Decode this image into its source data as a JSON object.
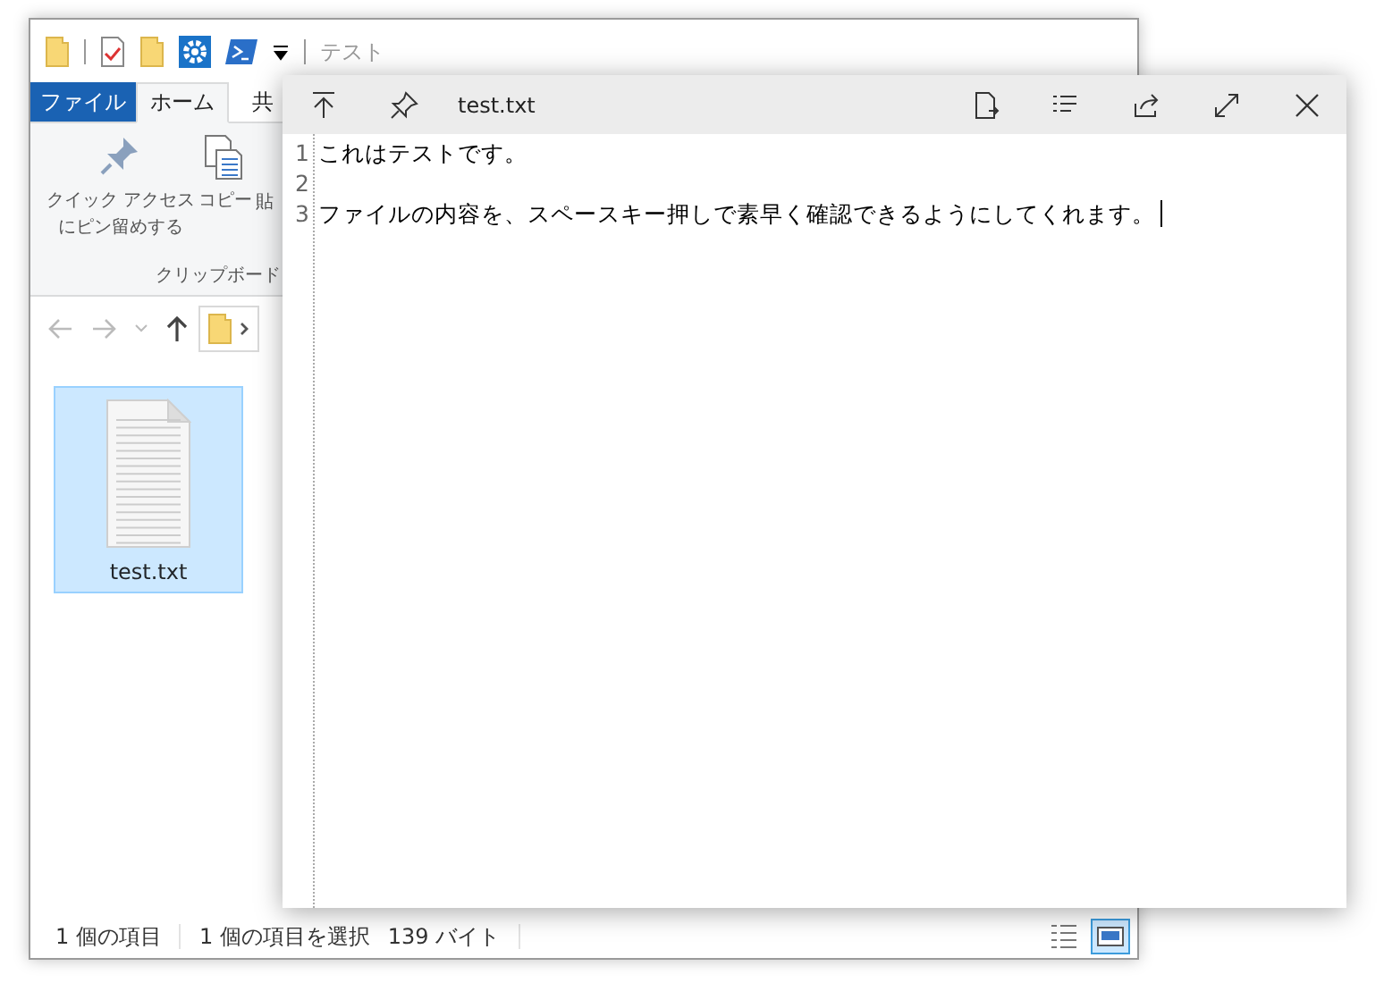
{
  "explorer": {
    "title": "テスト",
    "ribbon_tabs": [
      {
        "label": "ファイル",
        "kind": "file",
        "selected": false
      },
      {
        "label": "ホーム",
        "kind": "tab",
        "selected": true
      },
      {
        "label": "共",
        "kind": "tab",
        "selected": false
      }
    ],
    "ribbon_buttons": [
      {
        "kind": "pin",
        "lines": [
          "クイック アクセス",
          "にピン留めする"
        ]
      },
      {
        "kind": "copy",
        "lines": [
          "コピー"
        ]
      },
      {
        "kind": "paste",
        "lines": [
          "貼"
        ]
      }
    ],
    "group_label": "クリップボード",
    "file_item": {
      "name": "test.txt",
      "selected": true
    },
    "status_bar": [
      "1 個の項目",
      "1 個の項目を選択",
      "139 バイト"
    ],
    "view_buttons": [
      {
        "kind": "details",
        "selected": false
      },
      {
        "kind": "large-icons",
        "selected": true
      }
    ]
  },
  "preview": {
    "title": "test.txt",
    "caret_visible": true,
    "lines": [
      {
        "number": "1",
        "text": "これはテストです。"
      },
      {
        "number": "2"
      },
      {
        "number": "3",
        "text": "ファイルの内容を、スペースキー押しで素早く確認できるようにしてくれます。"
      }
    ]
  }
}
